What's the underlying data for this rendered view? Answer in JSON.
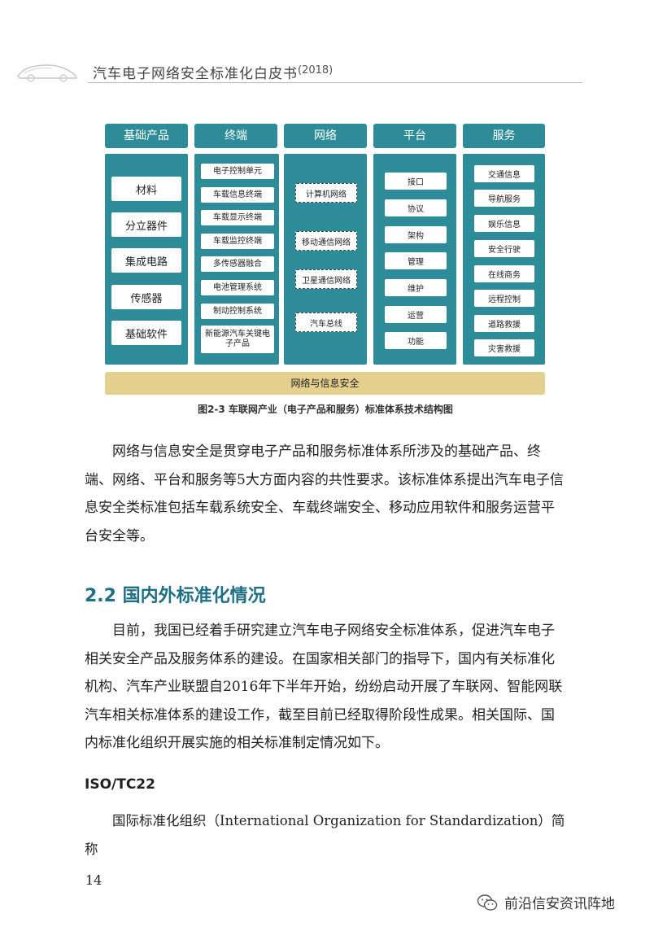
{
  "header": {
    "title": "汽车电子网络安全标准化白皮书",
    "year": "(2018)"
  },
  "figure": {
    "columns": [
      {
        "title": "基础产品",
        "items": [
          "材料",
          "分立器件",
          "集成电路",
          "传感器",
          "基础软件"
        ]
      },
      {
        "title": "终端",
        "items": [
          "电子控制单元",
          "车载信息终端",
          "车载显示终端",
          "车载监控终端",
          "多传感器融合",
          "电池管理系统",
          "制动控制系统",
          "新能源汽车关键电子产品"
        ]
      },
      {
        "title": "网络",
        "items": [
          "计算机网络",
          "移动通信网络",
          "卫星通信网络",
          "汽车总线"
        ]
      },
      {
        "title": "平台",
        "items": [
          "接口",
          "协议",
          "架构",
          "管理",
          "维护",
          "运营",
          "功能"
        ]
      },
      {
        "title": "服务",
        "items": [
          "交通信息",
          "导航服务",
          "娱乐信息",
          "安全行驶",
          "在线商务",
          "远程控制",
          "道路救援",
          "灾害救援"
        ]
      }
    ],
    "bottom_bar": "网络与信息安全",
    "caption": "图2-3 车联网产业（电子产品和服务）标准体系技术结构图"
  },
  "body": {
    "para1": "网络与信息安全是贯穿电子产品和服务标准体系所涉及的基础产品、终端、网络、平台和服务等5大方面内容的共性要求。该标准体系提出汽车电子信息安全类标准包括车载系统安全、车载终端安全、移动应用软件和服务运营平台安全等。",
    "section_title": "2.2 国内外标准化情况",
    "para2": "目前，我国已经着手研究建立汽车电子网络安全标准体系，促进汽车电子相关安全产品及服务体系的建设。在国家相关部门的指导下，国内有关标准化机构、汽车产业联盟自2016年下半年开始，纷纷启动开展了车联网、智能网联汽车相关标准体系的建设工作，截至目前已经取得阶段性成果。相关国际、国内标准化组织开展实施的相关标准制定情况如下。",
    "iso_heading": "ISO/TC22",
    "para3": "国际标准化组织（International Organization for Standardization）简称"
  },
  "footer": {
    "page_number": "14",
    "watermark": "前沿信安资讯阵地"
  },
  "colors": {
    "teal": "#2e8c98",
    "gold_bar": "#e3d08f",
    "section_heading": "#1f6f85"
  }
}
